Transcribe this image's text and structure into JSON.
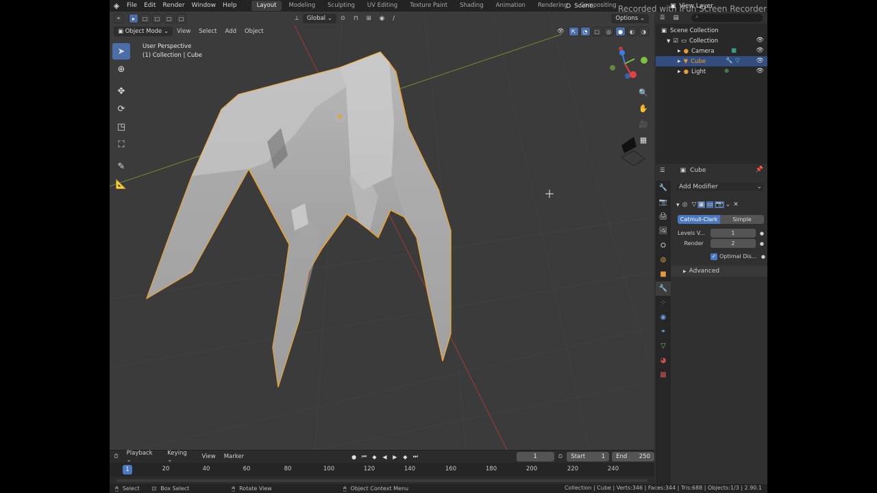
{
  "topbar": {
    "menus": [
      "File",
      "Edit",
      "Render",
      "Window",
      "Help"
    ],
    "workspaces": [
      "Layout",
      "Modeling",
      "Sculpting",
      "UV Editing",
      "Texture Paint",
      "Shading",
      "Animation",
      "Rendering",
      "Compositing"
    ],
    "active_workspace": "Layout",
    "scene": "Scene",
    "view_layer": "View Layer",
    "watermark": "Recorded with iFun Screen Recorder"
  },
  "viewport_header": {
    "transform_orientation": "Global",
    "options_label": "Options",
    "mode": "Object Mode",
    "menus": [
      "View",
      "Select",
      "Add",
      "Object"
    ]
  },
  "viewport_overlay": {
    "perspective": "User Perspective",
    "collection_info": "(1) Collection | Cube"
  },
  "tools": [
    "select-box-icon",
    "cursor-icon",
    "move-icon",
    "rotate-icon",
    "scale-icon",
    "transform-icon",
    "annotate-icon",
    "measure-icon"
  ],
  "gizmo_colors": {
    "x": "#e8413f",
    "y": "#7ec13f",
    "z": "#3b7de8"
  },
  "outliner": {
    "root": "Scene Collection",
    "items": [
      {
        "label": "Collection",
        "icon": "collection-icon"
      },
      {
        "label": "Camera",
        "icon": "camera-icon"
      },
      {
        "label": "Cube",
        "icon": "mesh-icon",
        "selected": true
      },
      {
        "label": "Light",
        "icon": "light-icon"
      }
    ]
  },
  "properties": {
    "object_name": "Cube",
    "add_modifier": "Add Modifier",
    "modifier_type_options": [
      "Catmull-Clark",
      "Simple"
    ],
    "selected_type": "Catmull-Clark",
    "levels_viewport_label": "Levels V...",
    "levels_viewport_value": "1",
    "render_label": "Render",
    "render_value": "2",
    "optimal_display": "Optimal Dis...",
    "advanced": "Advanced"
  },
  "timeline": {
    "menus": [
      "Playback",
      "Keying",
      "View",
      "Marker"
    ],
    "current_frame": "1",
    "start_label": "Start",
    "start_value": "1",
    "end_label": "End",
    "end_value": "250",
    "ruler_ticks": [
      "1",
      "20",
      "40",
      "60",
      "80",
      "100",
      "120",
      "140",
      "160",
      "180",
      "200",
      "220",
      "240"
    ]
  },
  "statusbar": {
    "select": "Select",
    "box_select": "Box Select",
    "rotate_view": "Rotate View",
    "context_menu": "Object Context Menu",
    "stats": "Collection | Cube | Verts:346 | Faces:344 | Tris:688 | Objects:1/3 | 2.90.1"
  },
  "colors": {
    "selection_outline": "#f0a020",
    "accent_blue": "#4b78c3"
  }
}
